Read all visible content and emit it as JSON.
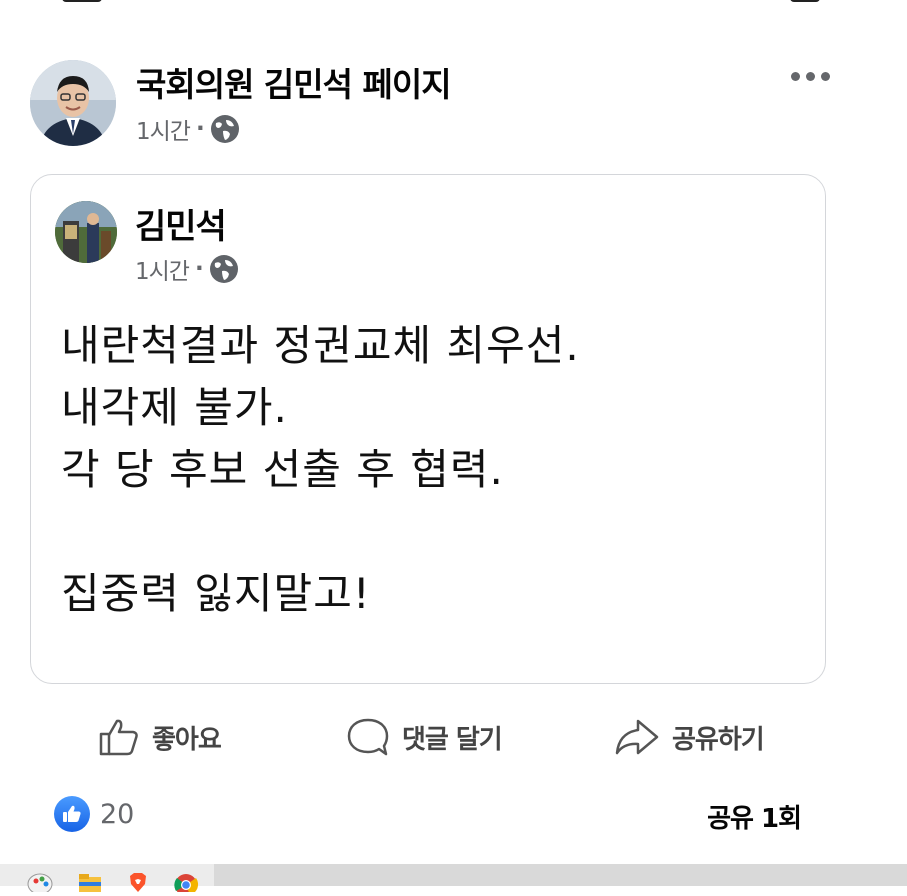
{
  "post": {
    "page_name": "국회의원 김민석 페이지",
    "time": "1시간",
    "separator": "·",
    "privacy_icon": "globe-icon",
    "more_icon": "more-options-icon"
  },
  "shared_post": {
    "author": "김민석",
    "time": "1시간",
    "separator": "·",
    "privacy_icon": "globe-icon",
    "lines": [
      "내란척결과 정권교체 최우선.",
      "내각제 불가.",
      "각 당 후보 선출 후 협력.",
      "",
      "집중력 잃지말고!"
    ]
  },
  "actions": {
    "like": "좋아요",
    "comment": "댓글 달기",
    "share": "공유하기"
  },
  "stats": {
    "reaction_count": "20",
    "share_count": "공유 1회"
  },
  "colors": {
    "like_blue": "#1877f2",
    "secondary_text": "#65676b",
    "card_border": "#d4d6da"
  },
  "taskbar": {
    "apps": [
      "paint-icon",
      "file-explorer-icon",
      "brave-browser-icon",
      "chrome-icon"
    ]
  }
}
